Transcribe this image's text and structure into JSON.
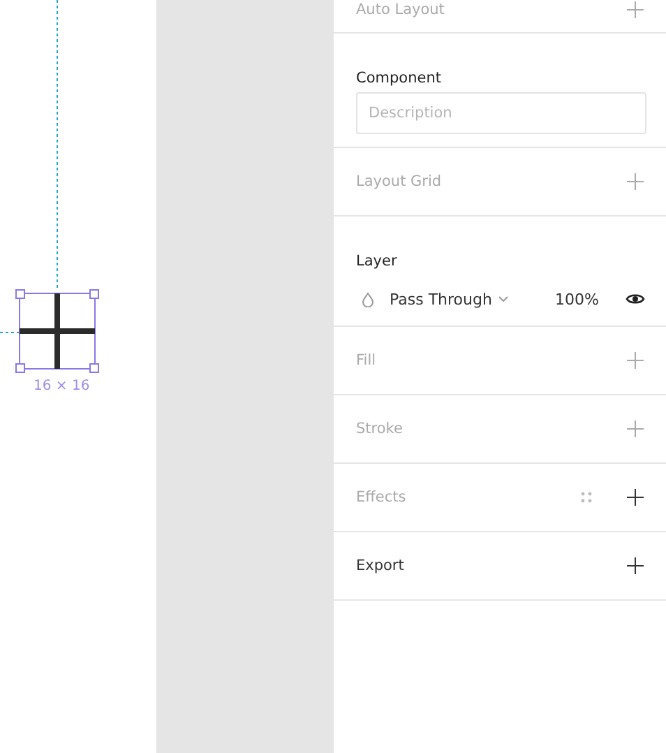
{
  "canvas": {
    "selection_size": "16 × 16"
  },
  "sections": [
    {
      "kind": "plain",
      "title": "Auto Layout",
      "active": false
    },
    {
      "kind": "component",
      "title": "Component",
      "active": true,
      "placeholder": "Description"
    },
    {
      "kind": "plain",
      "title": "Layout Grid",
      "active": false
    },
    {
      "kind": "layer",
      "title": "Layer",
      "active": true,
      "blend": "Pass Through",
      "opacity": "100%",
      "visible": true
    },
    {
      "kind": "plain",
      "title": "Fill",
      "active": false
    },
    {
      "kind": "plain",
      "title": "Stroke",
      "active": false
    },
    {
      "kind": "effects",
      "title": "Effects",
      "active": false
    },
    {
      "kind": "plain",
      "title": "Export",
      "active": true
    }
  ]
}
